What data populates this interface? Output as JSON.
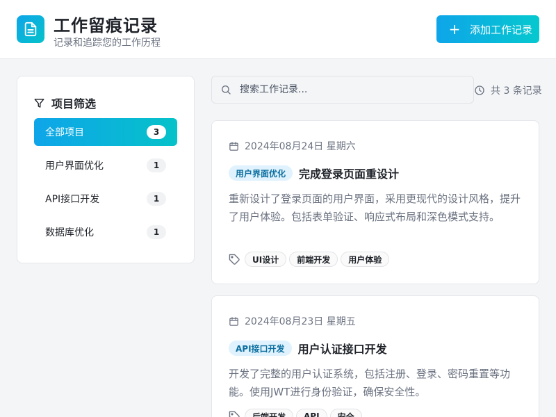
{
  "header": {
    "title": "工作留痕记录",
    "subtitle": "记录和追踪您的工作历程",
    "add_button_label": "添加工作记录",
    "add_button_icon": "plus-icon",
    "logo_icon": "document-icon"
  },
  "colors": {
    "accent_start": "#0ea5e9",
    "accent_end": "#06c2c9",
    "badge_bg": "#dff2fd",
    "badge_text": "#0b6ea0"
  },
  "sidebar": {
    "title": "项目筛选",
    "title_icon": "filter-icon",
    "items": [
      {
        "label": "全部项目",
        "count": "3",
        "active": true
      },
      {
        "label": "用户界面优化",
        "count": "1",
        "active": false
      },
      {
        "label": "API接口开发",
        "count": "1",
        "active": false
      },
      {
        "label": "数据库优化",
        "count": "1",
        "active": false
      }
    ]
  },
  "search": {
    "placeholder": "搜索工作记录...",
    "value": "",
    "total_text": "共 3 条记录"
  },
  "records": [
    {
      "date": "2024年08月24日 星期六",
      "project": "用户界面优化",
      "title": "完成登录页面重设计",
      "description": "重新设计了登录页面的用户界面，采用更现代的设计风格，提升了用户体验。包括表单验证、响应式布局和深色模式支持。",
      "tags": [
        "UI设计",
        "前端开发",
        "用户体验"
      ]
    },
    {
      "date": "2024年08月23日 星期五",
      "project": "API接口开发",
      "title": "用户认证接口开发",
      "description": "开发了完整的用户认证系统，包括注册、登录、密码重置等功能。使用JWT进行身份验证，确保安全性。",
      "tags": [
        "后端开发",
        "API",
        "安全"
      ]
    }
  ]
}
